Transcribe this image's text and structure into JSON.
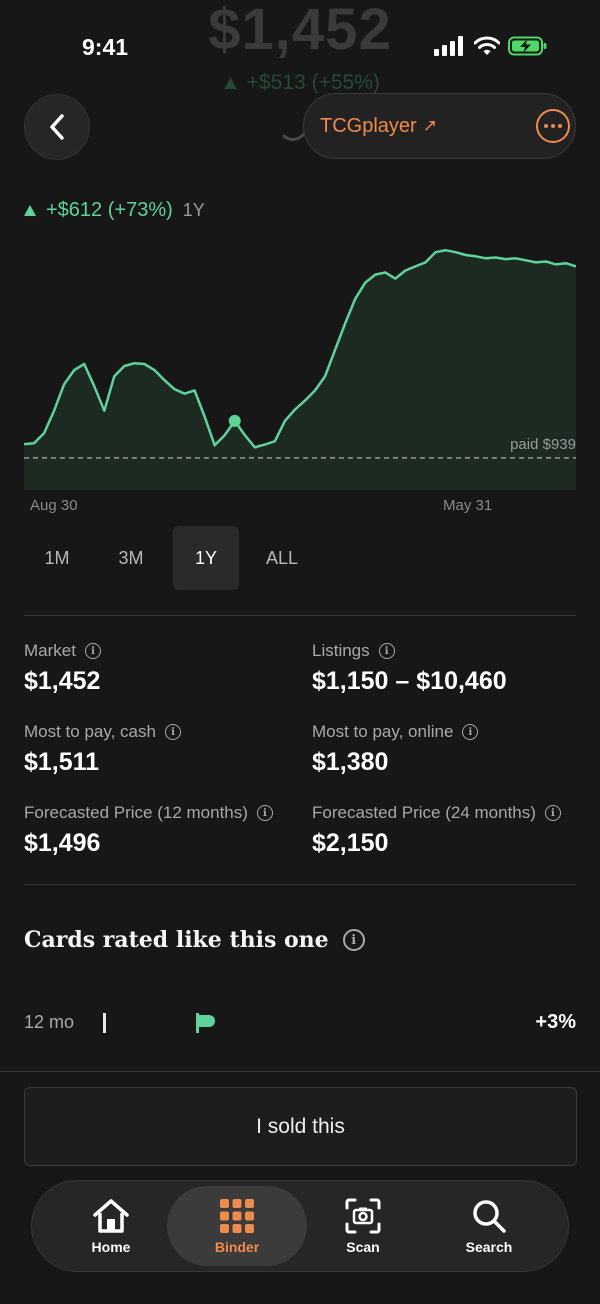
{
  "status_bar": {
    "time": "9:41"
  },
  "hero": {
    "price": "$1,452",
    "change": "▲ +$513 (+55%)"
  },
  "header": {
    "source_label": "TCGplayer",
    "source_arrow": "↗"
  },
  "change": {
    "text": "+$612 (+73%)",
    "period": "1Y"
  },
  "chart_data": {
    "type": "area",
    "x_labels": [
      "Aug 30",
      "May 31"
    ],
    "values": [
      973,
      975,
      1000,
      1055,
      1120,
      1155,
      1170,
      1115,
      1055,
      1140,
      1165,
      1172,
      1170,
      1155,
      1130,
      1108,
      1097,
      1105,
      1040,
      970,
      995,
      1030,
      995,
      965,
      972,
      980,
      1030,
      1058,
      1080,
      1105,
      1140,
      1205,
      1270,
      1330,
      1370,
      1390,
      1395,
      1380,
      1400,
      1410,
      1420,
      1445,
      1450,
      1445,
      1438,
      1435,
      1430,
      1432,
      1428,
      1430,
      1425,
      1420,
      1422,
      1415,
      1418,
      1410
    ],
    "marker_index": 21,
    "reference_line": {
      "value": 939,
      "label": "paid $939"
    },
    "line_color": "#5fd39a",
    "fill_color": "#1d2a22"
  },
  "ranges": [
    "1M",
    "3M",
    "1Y",
    "ALL"
  ],
  "active_range": "1Y",
  "stats": [
    {
      "label": "Market",
      "value": "$1,452"
    },
    {
      "label": "Listings",
      "value": "$1,150 – $10,460"
    },
    {
      "label": "Most to pay, cash",
      "value": "$1,511"
    },
    {
      "label": "Most to pay, online",
      "value": "$1,380"
    },
    {
      "label": "Forecasted Price (12 months)",
      "value": "$1,496"
    },
    {
      "label": "Forecasted Price (24 months)",
      "value": "$2,150"
    }
  ],
  "rated": {
    "title": "Cards rated like this one",
    "period": "12 mo",
    "change": "+3%"
  },
  "sold_button": "I sold this",
  "nav": [
    {
      "label": "Home",
      "icon": "home-icon"
    },
    {
      "label": "Binder",
      "icon": "grid-icon"
    },
    {
      "label": "Scan",
      "icon": "camera-scan-icon"
    },
    {
      "label": "Search",
      "icon": "search-icon"
    }
  ],
  "colors": {
    "accent": "#ee8a4c",
    "positive": "#5fd39a",
    "background": "#171717"
  }
}
